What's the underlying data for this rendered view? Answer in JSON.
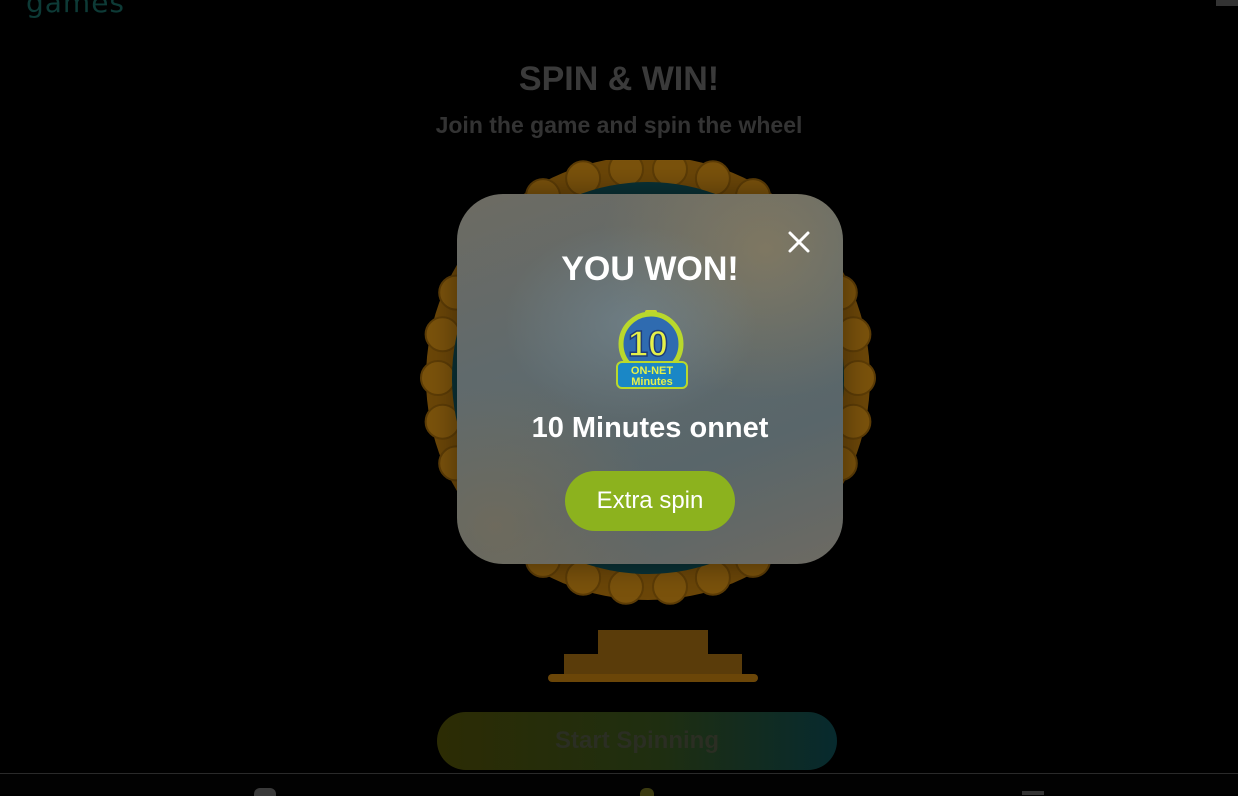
{
  "header": {
    "logo_text": "games"
  },
  "main": {
    "title": "SPIN & WIN!",
    "subtitle": "Join the game and spin the wheel",
    "start_button_label": "Start Spinning"
  },
  "modal": {
    "title": "YOU WON!",
    "prize_name": "10 Minutes onnet",
    "extra_spin_label": "Extra spin",
    "close_icon": "close-icon",
    "prize_icon": {
      "name": "on-net-minutes-icon",
      "number": "10",
      "line1": "ON-NET",
      "line2": "Minutes"
    }
  },
  "colors": {
    "accent_green": "#8cb21e",
    "wheel_rim": "#6b4608",
    "wheel_center": "#0a3236",
    "overlay": "#000000"
  }
}
